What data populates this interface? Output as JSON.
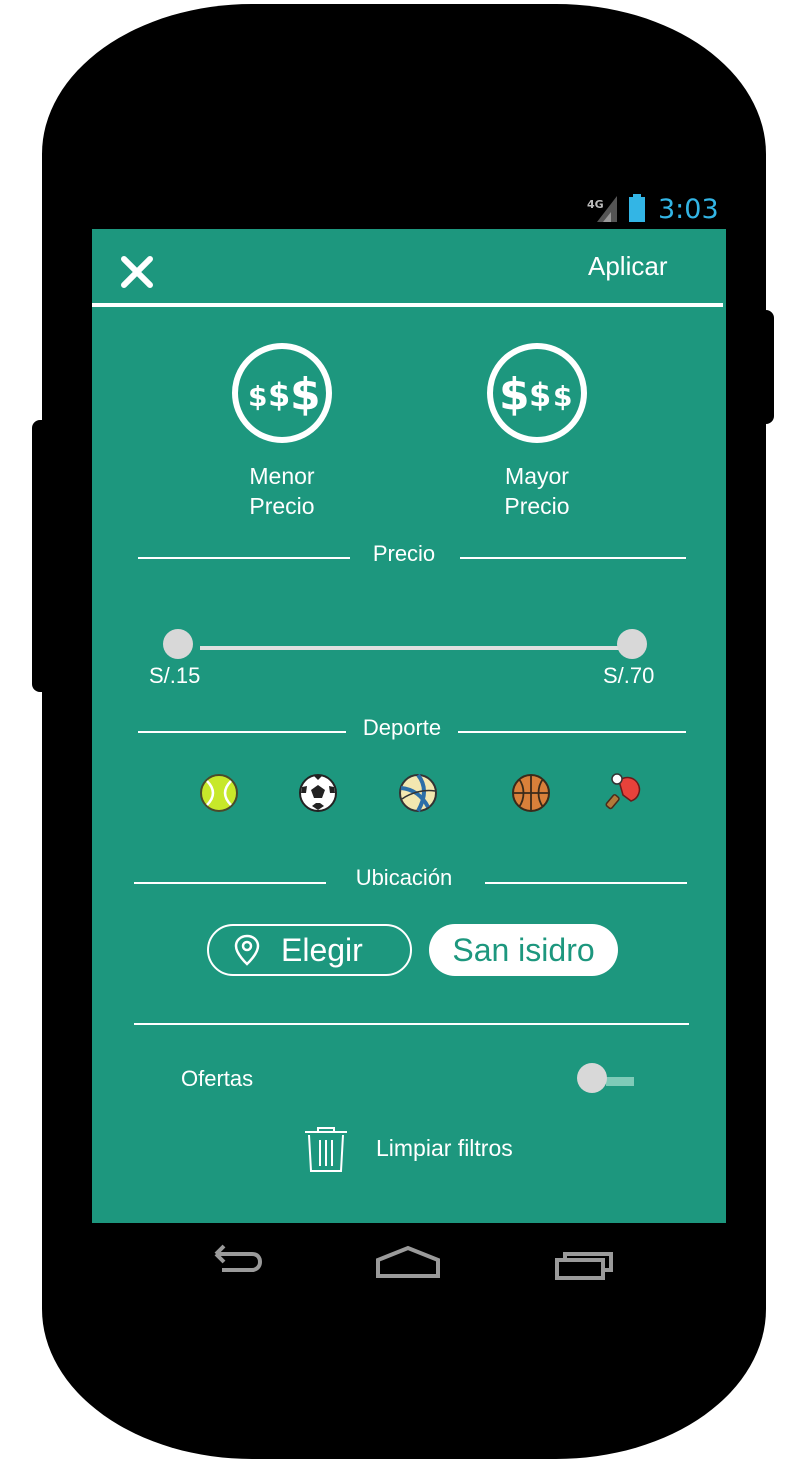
{
  "status_bar": {
    "network": "4G",
    "time": "3:03"
  },
  "header": {
    "close_icon": "close-icon",
    "apply_label": "Aplicar"
  },
  "price_sort": {
    "low": {
      "symbol": "$$$",
      "line1": "Menor",
      "line2": "Precio"
    },
    "high": {
      "symbol": "$$$",
      "line1": "Mayor",
      "line2": "Precio"
    }
  },
  "sections": {
    "price": "Precio",
    "sport": "Deporte",
    "location": "Ubicación"
  },
  "price_range": {
    "min_label": "S/.15",
    "max_label": "S/.70",
    "min": 15,
    "max": 70
  },
  "sports": [
    "tennis-ball-icon",
    "soccer-ball-icon",
    "volleyball-icon",
    "basketball-icon",
    "ping-pong-icon"
  ],
  "location": {
    "choose_label": "Elegir",
    "selected": "San isidro"
  },
  "offers": {
    "label": "Ofertas",
    "enabled": false
  },
  "clear_filters": "Limpiar filtros",
  "colors": {
    "accent": "#1d977e",
    "status_text": "#33b5e5"
  }
}
